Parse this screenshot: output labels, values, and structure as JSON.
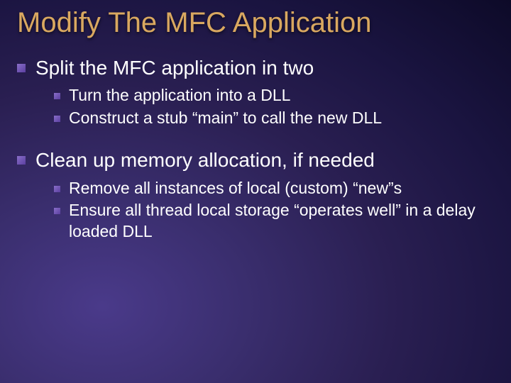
{
  "title": "Modify The MFC Application",
  "items": [
    {
      "text": "Split the MFC application in two",
      "subitems": [
        {
          "text": "Turn the application into a DLL"
        },
        {
          "text": "Construct a stub “main” to call the new DLL"
        }
      ]
    },
    {
      "text": "Clean up memory allocation, if needed",
      "subitems": [
        {
          "text": "Remove all instances of local (custom) “new”s"
        },
        {
          "text": "Ensure all thread local storage “operates well” in a delay loaded DLL"
        }
      ]
    }
  ]
}
